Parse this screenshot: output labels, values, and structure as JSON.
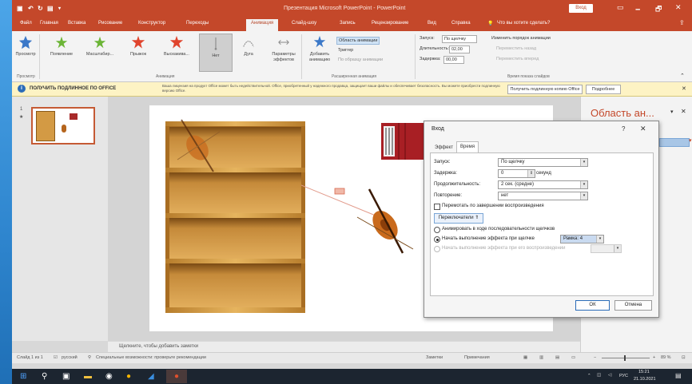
{
  "window": {
    "title": "Презентация Microsoft PowerPoint - PowerPoint",
    "signin": "Вход",
    "controls": [
      "🗕",
      "🗗",
      "✕"
    ]
  },
  "tabs": [
    {
      "label": "Файл"
    },
    {
      "label": "Главная"
    },
    {
      "label": "Вставка"
    },
    {
      "label": "Рисование"
    },
    {
      "label": "Конструктор"
    },
    {
      "label": "Переходы"
    },
    {
      "label": "Анимация",
      "active": true
    },
    {
      "label": "Слайд-шоу"
    },
    {
      "label": "Запись"
    },
    {
      "label": "Рецензирование"
    },
    {
      "label": "Вид"
    },
    {
      "label": "Справка"
    },
    {
      "label": "Что вы хотите сделать?"
    }
  ],
  "ribbon": {
    "preview_label": "Просмотр",
    "effects": [
      "Появление",
      "Масштабир...",
      "Прыжок",
      "Выскакива...",
      "Нет",
      "Дуга"
    ],
    "effect_params": "Параметры эффектов",
    "add_animation": "Добавить анимацию",
    "anim_pane_btn": "Область анимации",
    "trigger": "Триггер",
    "anim_painter": "По образцу анимации",
    "start_label": "Запуск:",
    "start_value": "По щелчку",
    "duration_label": "Длительность:",
    "duration_value": "02,00",
    "delay_label": "Задержка:",
    "delay_value": "00,00",
    "reorder_label": "Изменить порядок анимации",
    "move_earlier": "Переместить назад",
    "move_later": "Переместить вперед",
    "groups": [
      "Просмотр",
      "Анимация",
      "Расширенная анимация",
      "Время показа слайдов"
    ],
    "accent_color": "#c4482a"
  },
  "info_bar": {
    "title": "ПОЛУЧИТЬ ПОДЛИННОЕ ПО OFFICE",
    "text": "Ваша лицензия на продукт Office может быть недействительной. Office, приобретенный у надежного продавца, защищает ваши файлы и обеспечивает безопасность. Вы можете приобрести подлинную версию Office.",
    "btn_primary": "Получить подлинную копию Office",
    "btn_secondary": "Подробнее",
    "close": "✕"
  },
  "slide_pane": {
    "slide_number": "1",
    "star": "★"
  },
  "notes": {
    "placeholder": "Щелкните, чтобы добавить заметки"
  },
  "anim_pane": {
    "title": "Область ан...",
    "close": "✕"
  },
  "dialog": {
    "title": "Вход",
    "help": "?",
    "close": "✕",
    "tabs": [
      {
        "label": "Эффект"
      },
      {
        "label": "Время",
        "active": true
      }
    ],
    "start_label": "Запуск:",
    "start_value": "По щелчку",
    "delay_label": "Задержка:",
    "delay_value": "0",
    "delay_unit": "секунд",
    "duration_label": "Продолжительность:",
    "duration_value": "2 сек. (средне)",
    "repeat_label": "Повторение:",
    "repeat_value": "нет",
    "rewind_label": "Перемотать по завершении воспроизведения",
    "triggers_button": "Переключатели ⇑",
    "animate_seq_label": "Анимировать в ходе последовательности щелчков",
    "start_on_click_label": "Начать выполнение эффекта при щелчке",
    "start_on_click_value": "Рамка: 4",
    "start_on_play_label": "Начать выполнение эффекта при его воспроизведении",
    "ok": "ОК",
    "cancel": "Отмена"
  },
  "status": {
    "slide_info": "Слайд 1 из 1",
    "language": "русский",
    "accessibility": "Специальные возможности: проверьте рекомендации",
    "notes_btn": "Заметки",
    "comments_btn": "Примечания",
    "zoom": "89 %"
  },
  "taskbar": {
    "lang": "РУС",
    "time": "15:21",
    "date": "21.10.2021"
  }
}
